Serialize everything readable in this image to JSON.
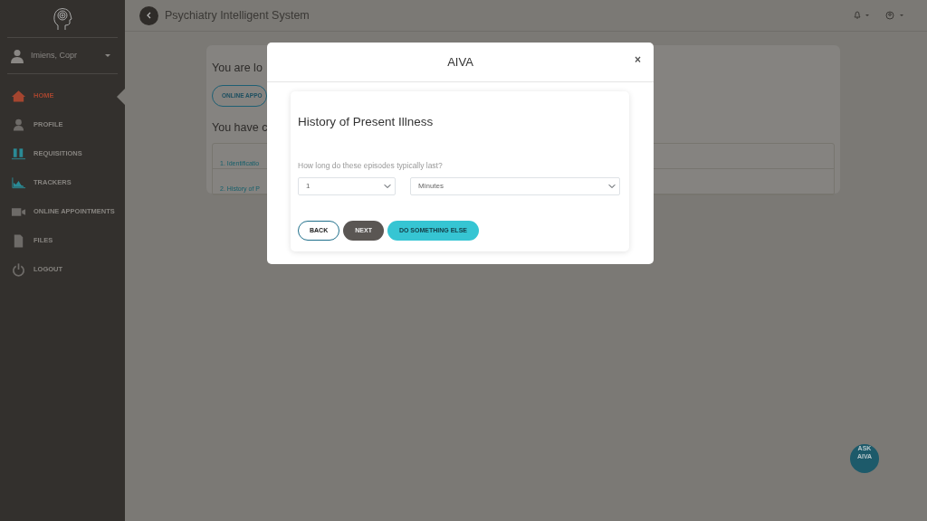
{
  "sidebar": {
    "user": "Imiens, Copr",
    "items": [
      {
        "label": "HOME",
        "selected": true
      },
      {
        "label": "PROFILE",
        "selected": false
      },
      {
        "label": "REQUISITIONS",
        "selected": false
      },
      {
        "label": "TRACKERS",
        "selected": false
      },
      {
        "label": "ONLINE APPOINTMENTS",
        "selected": false
      },
      {
        "label": "FILES",
        "selected": false
      },
      {
        "label": "LOGOUT",
        "selected": false
      }
    ]
  },
  "header": {
    "title": "Psychiatry Intelligent System"
  },
  "background_card": {
    "heading": "You are lo",
    "button": "ONLINE APPO",
    "subheading": "You have c",
    "links": [
      "1. Identificatio",
      "2. History of P"
    ]
  },
  "modal": {
    "title": "AIVA",
    "close": "×",
    "section_title": "History of Present Illness",
    "question": "How long do these episodes typically last?",
    "selects": [
      {
        "value": "1"
      },
      {
        "value": "Minutes"
      }
    ],
    "buttons": [
      {
        "label": "BACK",
        "kind": "outline"
      },
      {
        "label": "NEXT",
        "kind": "dark"
      },
      {
        "label": "DO SOMETHING ELSE",
        "kind": "teal"
      }
    ]
  },
  "ask_button": {
    "lines": [
      "ASK",
      "AIVA"
    ]
  }
}
